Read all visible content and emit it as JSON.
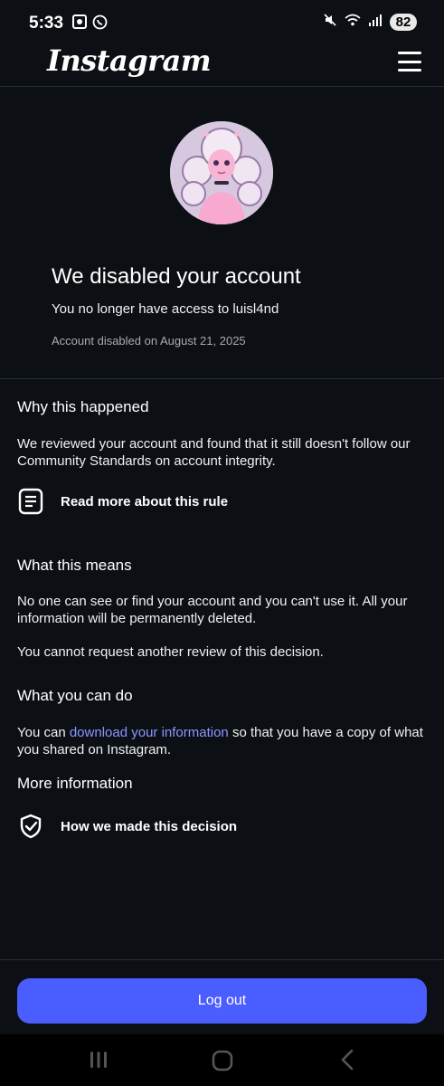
{
  "status_bar": {
    "time": "5:33",
    "battery": "82",
    "icons": [
      "gallery-icon",
      "whatsapp-icon",
      "mute-icon",
      "wifi-icon",
      "signal-icon"
    ]
  },
  "app": {
    "logo": "Instagram",
    "menu_icon": "hamburger-menu-icon"
  },
  "hero": {
    "title": "We disabled your account",
    "subtitle": "You no longer have access to luisl4nd",
    "date": "Account disabled on August 21, 2025"
  },
  "why": {
    "title": "Why this happened",
    "body": "We reviewed your account and found that it still doesn't follow our Community Standards on account integrity.",
    "link_label": "Read more about this rule",
    "link_icon": "document-icon"
  },
  "means": {
    "title": "What this means",
    "body1": "No one can see or find your account and you can't use it. All your information will be permanently deleted.",
    "body2": "You cannot request another review of this decision."
  },
  "can_do": {
    "title": "What you can do",
    "prefix": "You can ",
    "link": "download your information",
    "suffix": " so that you have a copy of what you shared on Instagram."
  },
  "more": {
    "title": "More information",
    "link_label": "How we made this decision",
    "link_icon": "shield-check-icon"
  },
  "footer": {
    "logout_label": "Log out"
  },
  "colors": {
    "background": "#0c1014",
    "accent": "#4a5dff",
    "link": "#8b96ff"
  },
  "nav": {
    "icons": [
      "recent-apps-icon",
      "home-icon",
      "back-icon"
    ]
  }
}
